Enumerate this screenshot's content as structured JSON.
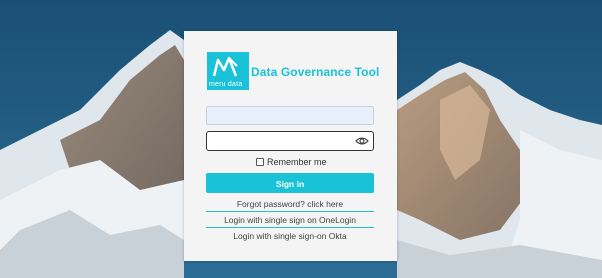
{
  "brand": {
    "logo_text": "meru data",
    "app_title": "Data Governance Tool",
    "accent_color": "#19c2d6"
  },
  "login": {
    "username_value": "",
    "password_value": "",
    "show_password_icon": "eye-icon",
    "remember_label": "Remember me",
    "remember_checked": false,
    "signin_label": "Sign in"
  },
  "links": {
    "forgot": "Forgot password? click here",
    "onelogin": "Login with single sign on OneLogin",
    "okta": "Login with single sign-on Okta"
  },
  "background": {
    "subject": "snowy-mountain",
    "sky_color": "#1f5a80"
  }
}
